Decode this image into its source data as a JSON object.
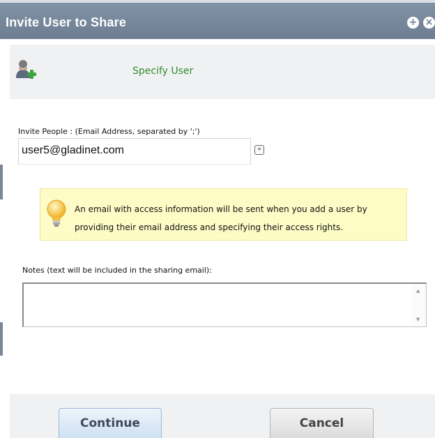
{
  "dialog": {
    "title": "Invite User to Share",
    "title_icons": [
      "add-circle-icon",
      "close-circle-icon"
    ],
    "header": {
      "title": "Specify User",
      "icon": "add-user-icon"
    },
    "invite": {
      "label": "Invite People : (Email Address, separated by ';')",
      "value": "user5@gladinet.com",
      "expand_icon": "double-chevron-down-icon"
    },
    "info": {
      "icon": "lightbulb-icon",
      "text": "An email with access information will be sent when you add a user by providing their email address and specifying their access rights."
    },
    "notes": {
      "label": "Notes (text will be included in the sharing email):",
      "value": ""
    },
    "buttons": {
      "continue_label": "Continue",
      "cancel_label": "Cancel"
    },
    "colors": {
      "title_bar": "#7a8a9d",
      "header_text": "#2f8f2f",
      "info_bg": "#fefcc6",
      "info_border": "#ede69b",
      "panel_bg": "#f0f1f2"
    }
  }
}
